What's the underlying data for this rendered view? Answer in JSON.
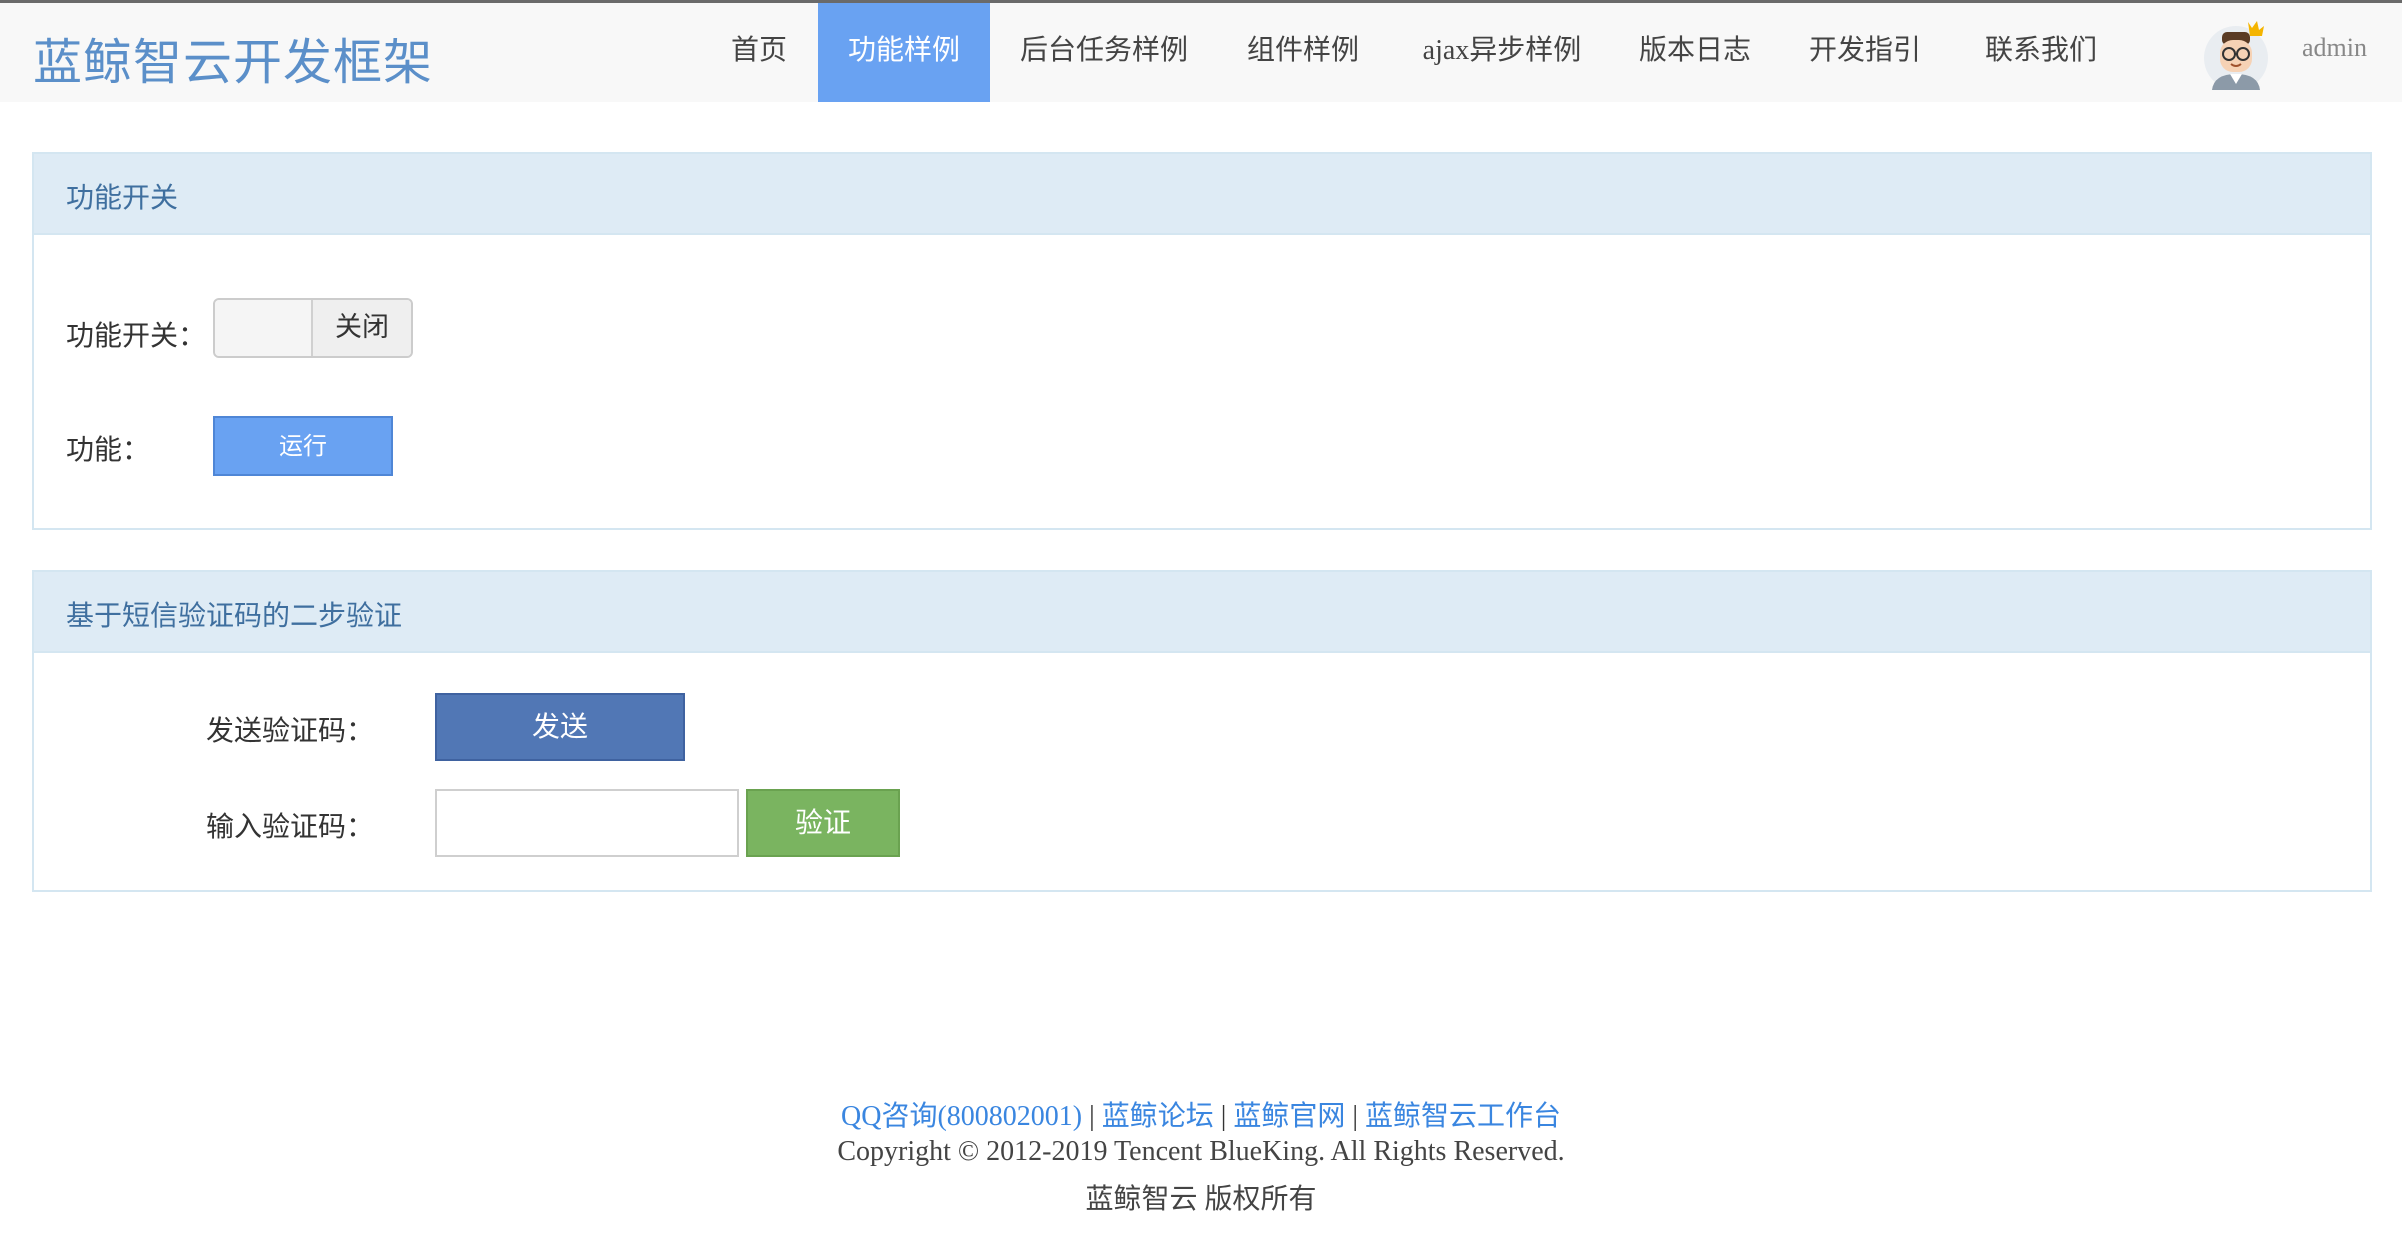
{
  "header": {
    "brand": "蓝鲸智云开发框架",
    "nav": [
      {
        "label": "首页",
        "active": false
      },
      {
        "label": "功能样例",
        "active": true
      },
      {
        "label": "后台任务样例",
        "active": false
      },
      {
        "label": "组件样例",
        "active": false
      },
      {
        "label": "ajax异步样例",
        "active": false
      },
      {
        "label": "版本日志",
        "active": false
      },
      {
        "label": "开发指引",
        "active": false
      },
      {
        "label": "联系我们",
        "active": false
      }
    ],
    "username": "admin",
    "avatar_icon": "user-avatar-icon"
  },
  "feature_panel": {
    "title": "功能开关",
    "switch_label": "功能开关：",
    "switch_state": "关闭",
    "func_label": "功能：",
    "run_button": "运行"
  },
  "sms_panel": {
    "title": "基于短信验证码的二步验证",
    "send_label": "发送验证码：",
    "send_button": "发送",
    "input_label": "输入验证码：",
    "input_value": "",
    "input_placeholder": "",
    "verify_button": "验证"
  },
  "footer": {
    "links": [
      "QQ咨询(800802001)",
      "蓝鲸论坛",
      "蓝鲸官网",
      "蓝鲸智云工作台"
    ],
    "separator": "|",
    "copyright": "Copyright © 2012-2019 Tencent BlueKing. All Rights Reserved.",
    "rights": "蓝鲸智云 版权所有"
  },
  "colors": {
    "brand": "#5b8fc9",
    "nav_active_bg": "#69a2f2",
    "panel_header_bg": "#deebf5",
    "send_button": "#5177b5",
    "verify_button": "#7ab460",
    "link": "#3a86e0"
  }
}
